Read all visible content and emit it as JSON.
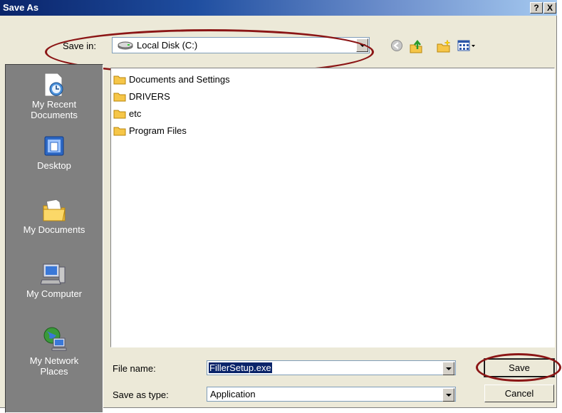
{
  "window": {
    "title": "Save As",
    "help_label": "?",
    "close_label": "X"
  },
  "save_in": {
    "label": "Save in:",
    "value": "Local Disk (C:)",
    "icon": "hard-disk-icon"
  },
  "toolbar": {
    "icons": [
      "back-icon",
      "up-folder-icon",
      "new-folder-icon",
      "views-menu-icon"
    ]
  },
  "places": [
    {
      "label": "My Recent Documents",
      "line1": "My Recent",
      "line2": "Documents",
      "icon": "recent-documents-icon"
    },
    {
      "label": "Desktop",
      "line1": "Desktop",
      "line2": "",
      "icon": "desktop-icon"
    },
    {
      "label": "My Documents",
      "line1": "My Documents",
      "line2": "",
      "icon": "my-documents-icon"
    },
    {
      "label": "My Computer",
      "line1": "My Computer",
      "line2": "",
      "icon": "my-computer-icon"
    },
    {
      "label": "My Network Places",
      "line1": "My Network",
      "line2": "Places",
      "icon": "network-places-icon"
    }
  ],
  "files": [
    {
      "name": "Documents and Settings",
      "icon": "folder-icon"
    },
    {
      "name": "DRIVERS",
      "icon": "folder-icon"
    },
    {
      "name": "etc",
      "icon": "folder-icon"
    },
    {
      "name": "Program Files",
      "icon": "folder-icon"
    }
  ],
  "file_name": {
    "label": "File name:",
    "value": "FillerSetup.exe"
  },
  "save_as_type": {
    "label": "Save as type:",
    "value": "Application"
  },
  "buttons": {
    "save": "Save",
    "cancel": "Cancel"
  },
  "colors": {
    "annotation": "#8b1515",
    "title_bar": "#0a246a",
    "selection": "#0a246a",
    "dialog_bg": "#ece9d8",
    "places_bg": "#808080"
  }
}
